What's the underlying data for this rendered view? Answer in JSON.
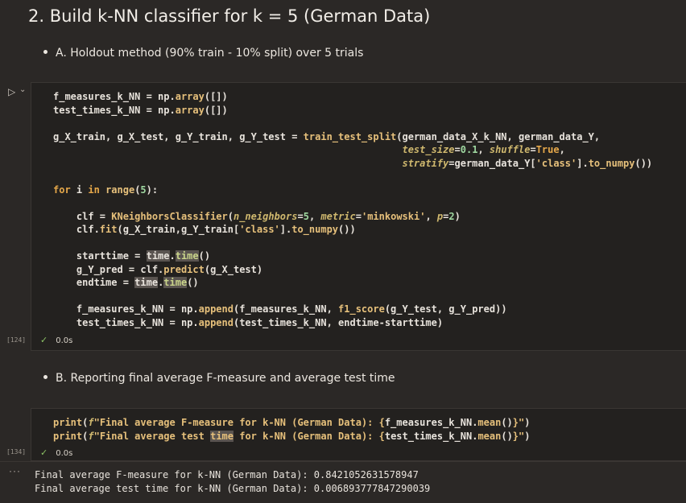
{
  "heading": "2. Build k-NN classifier for k = 5 (German Data)",
  "bullet_a": "A. Holdout method (90% train - 10% split) over 5 trials",
  "bullet_b": "B. Reporting final average F-measure and average test time",
  "cell1": {
    "exec_count": "[124]",
    "status": "0.0s",
    "lines": [
      "f_measures_k_NN = np.array([])",
      "test_times_k_NN = np.array([])",
      "",
      "g_X_train, g_X_test, g_Y_train, g_Y_test = train_test_split(german_data_X_k_NN, german_data_Y,",
      "                                                            test_size=0.1, shuffle=True,",
      "                                                            stratify=german_data_Y['class'].to_numpy())",
      "",
      "for i in range(5):",
      "",
      "    clf = KNeighborsClassifier(n_neighbors=5, metric='minkowski', p=2)",
      "    clf.fit(g_X_train,g_Y_train['class'].to_numpy())",
      "",
      "    starttime = time.time()",
      "    g_Y_pred = clf.predict(g_X_test)",
      "    endtime = time.time()",
      "",
      "    f_measures_k_NN = np.append(f_measures_k_NN, f1_score(g_Y_test, g_Y_pred))",
      "    test_times_k_NN = np.append(test_times_k_NN, endtime-starttime)"
    ]
  },
  "cell2": {
    "exec_count": "[134]",
    "status": "0.0s",
    "lines": [
      "print(f\"Final average F-measure for k-NN (German Data): {f_measures_k_NN.mean()}\")",
      "print(f\"Final average test time for k-NN (German Data): {test_times_k_NN.mean()}\")"
    ]
  },
  "output": {
    "menu_glyph": "···",
    "lines": [
      "Final average F-measure for k-NN (German Data): 0.8421052631578947",
      "Final average test time for k-NN (German Data): 0.006893777847290039"
    ]
  },
  "icons": {
    "run": "run-icon",
    "chevron": "chevron-down-icon",
    "check": "check-icon",
    "more": "ellipsis-icon"
  },
  "colors": {
    "background": "#2b2826",
    "cell_background": "#23211f",
    "keyword": "#e6a84a",
    "number": "#9fd7a0",
    "success": "#8cc265"
  }
}
